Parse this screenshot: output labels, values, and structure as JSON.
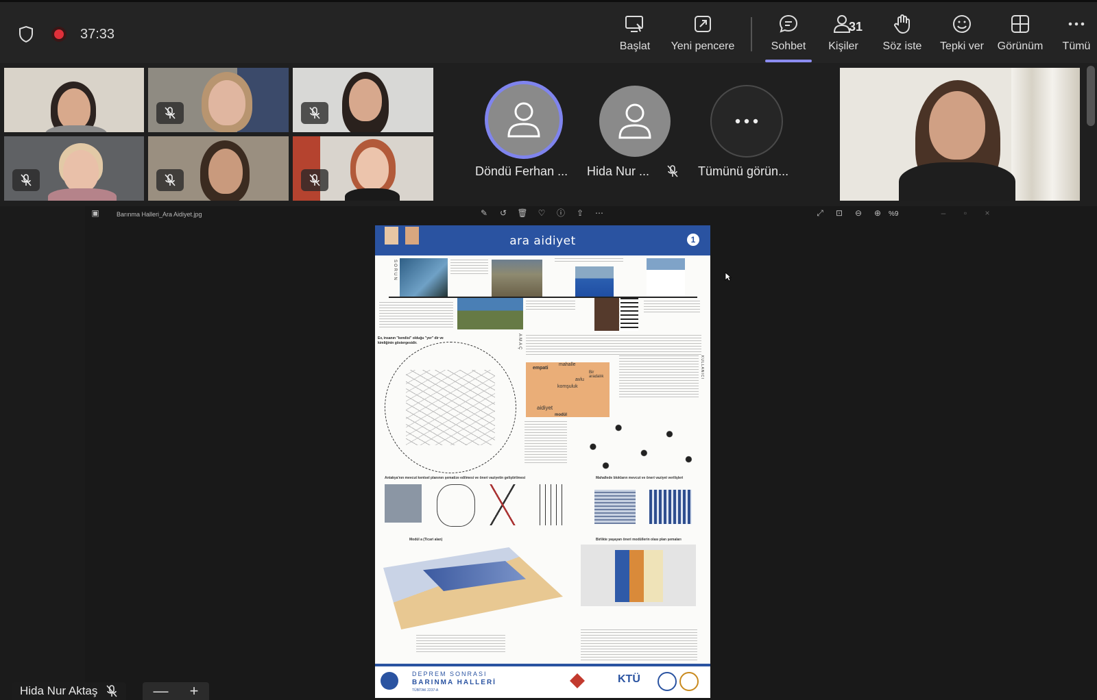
{
  "topbar": {
    "timer": "37:33",
    "buttons": [
      {
        "label": "Başlat",
        "icon": "share-screen-icon"
      },
      {
        "label": "Yeni pencere",
        "icon": "new-window-icon"
      },
      {
        "label": "Sohbet",
        "icon": "chat-icon"
      },
      {
        "label": "Kişiler",
        "icon": "people-icon"
      },
      {
        "label": "Söz iste",
        "icon": "raise-hand-icon"
      },
      {
        "label": "Tepki ver",
        "icon": "react-icon"
      },
      {
        "label": "Görünüm",
        "icon": "view-icon"
      },
      {
        "label": "Tümü",
        "icon": "more-icon"
      }
    ],
    "people_count": "31",
    "active_tab": "Sohbet"
  },
  "participants": {
    "avatars": [
      {
        "name": "Döndü Ferhan ...",
        "speaking": true
      },
      {
        "name": "Hida Nur ...",
        "muted": true
      }
    ],
    "see_all": "Tümünü görün..."
  },
  "viewer": {
    "file_name": "Barınma Halleri_Ara Aidiyet.jpg",
    "zoom": "%9"
  },
  "poster": {
    "title": "ara aidiyet",
    "page_number": "1",
    "side_label_1": "SORUN",
    "side_label_2": "AMAÇ",
    "side_label_3": "KULLANICI",
    "words": {
      "empati": "empati",
      "mahalle": "mahalle",
      "avlu": "avlu",
      "bir_aradalik": "Bir aradalık",
      "komsuluk": "komşuluk",
      "aidiyet": "aidiyet",
      "modul": "modül"
    },
    "section_1": "Antakya'nın mevcut kentsel planının şematize edilmesi ve öneri vaziyetin geliştirilmesi",
    "section_2": "Mahallede blokların mevcut ve öneri vaziyet verilişleri",
    "section_3": "Modül a (Ticari alan)",
    "section_4": "Birlikte yaşayan öneri modüllerin olası plan şemaları",
    "question": "Ev, insanın \"kendisi\" olduğu \"yer\" dir ve kimliğinin göstergesidir.",
    "footer_title_1": "DEPREM SONRASI",
    "footer_title_2": "BARINMA HALLERİ",
    "footer_sub": "TÜBİTAK 2237-A",
    "footer_logo": "KTÜ"
  },
  "speaker_name": "Hida Nur Aktaş",
  "zoom_controls": {
    "minus": "—",
    "plus": "+"
  }
}
